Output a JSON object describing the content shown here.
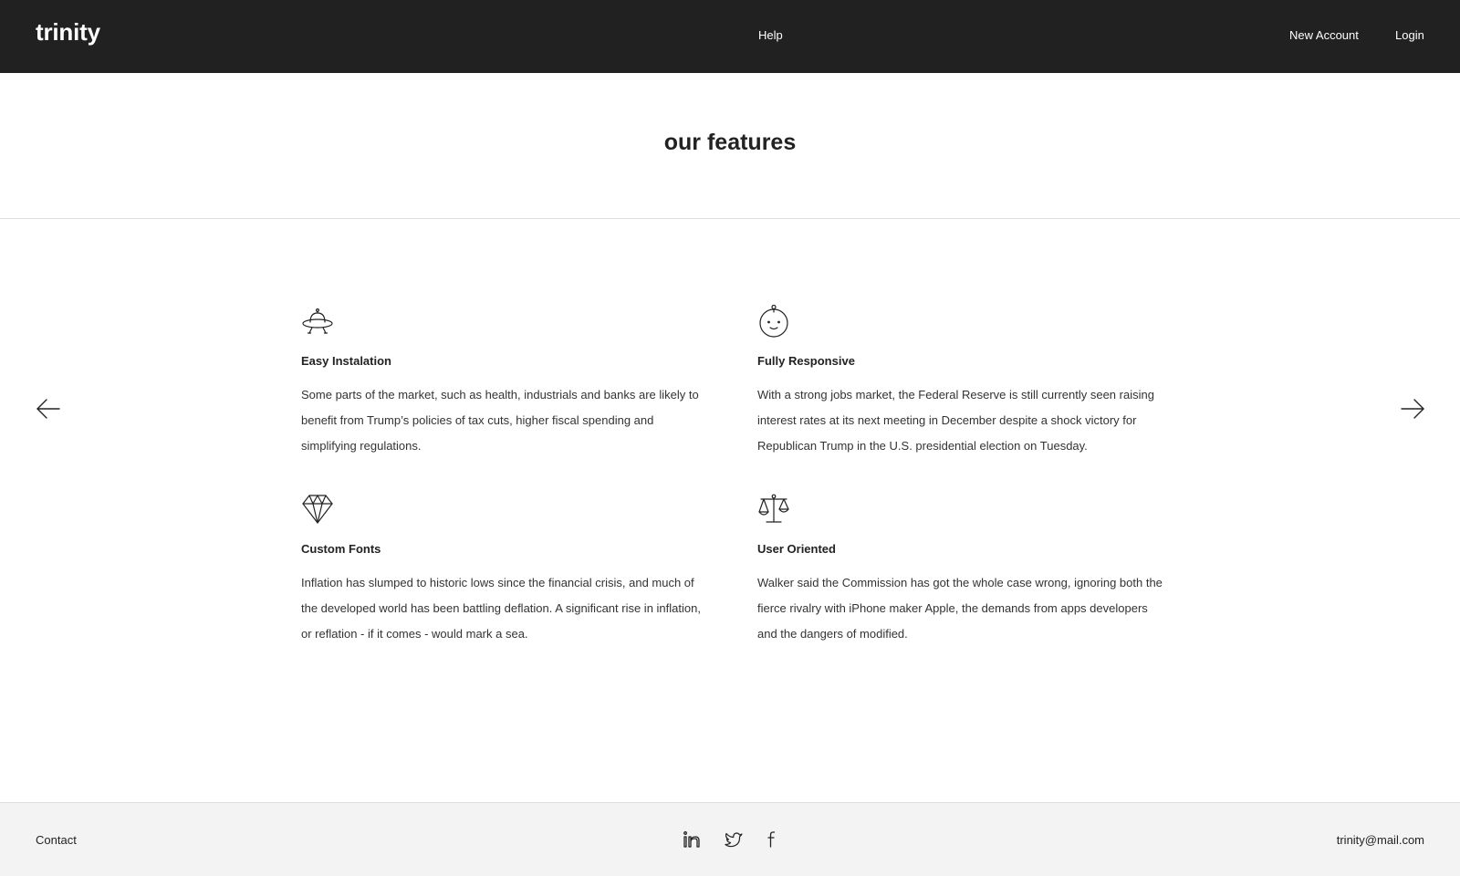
{
  "header": {
    "logo": "trinity",
    "nav": {
      "help": "Help",
      "new_account": "New Account",
      "login": "Login"
    },
    "background": "#212121"
  },
  "hero": {
    "title": "our features"
  },
  "carousel": {
    "prev_icon": "arrow-left-icon",
    "next_icon": "arrow-right-icon"
  },
  "features": [
    {
      "icon": "ufo-icon",
      "title": "Easy Instalation",
      "text": "Some parts of the market, such as health, industrials and banks are likely to benefit from Trump’s policies of tax cuts, higher fiscal spending and simplifying regulations."
    },
    {
      "icon": "baby-face-icon",
      "title": "Fully Responsive",
      "text": "With a strong jobs market, the Federal Reserve is still currently seen raising interest rates at its next meeting in December despite a shock victory for Republican Trump in the U.S. presidential election on Tuesday."
    },
    {
      "icon": "diamond-icon",
      "title": "Custom Fonts",
      "text": "Inflation has slumped to historic lows since the financial crisis, and much of the developed world has been battling deflation. A significant rise in inflation, or reflation - if it comes - would mark a sea."
    },
    {
      "icon": "scales-icon",
      "title": "User Oriented",
      "text": "Walker said the Commission has got the whole case wrong, ignoring both the fierce rivalry with iPhone maker Apple, the demands from apps developers and the dangers of modified."
    }
  ],
  "footer": {
    "contact": "Contact",
    "email": "trinity@mail.com",
    "social": [
      "linkedin-icon",
      "twitter-icon",
      "facebook-icon"
    ],
    "background": "#f3f3f3"
  }
}
